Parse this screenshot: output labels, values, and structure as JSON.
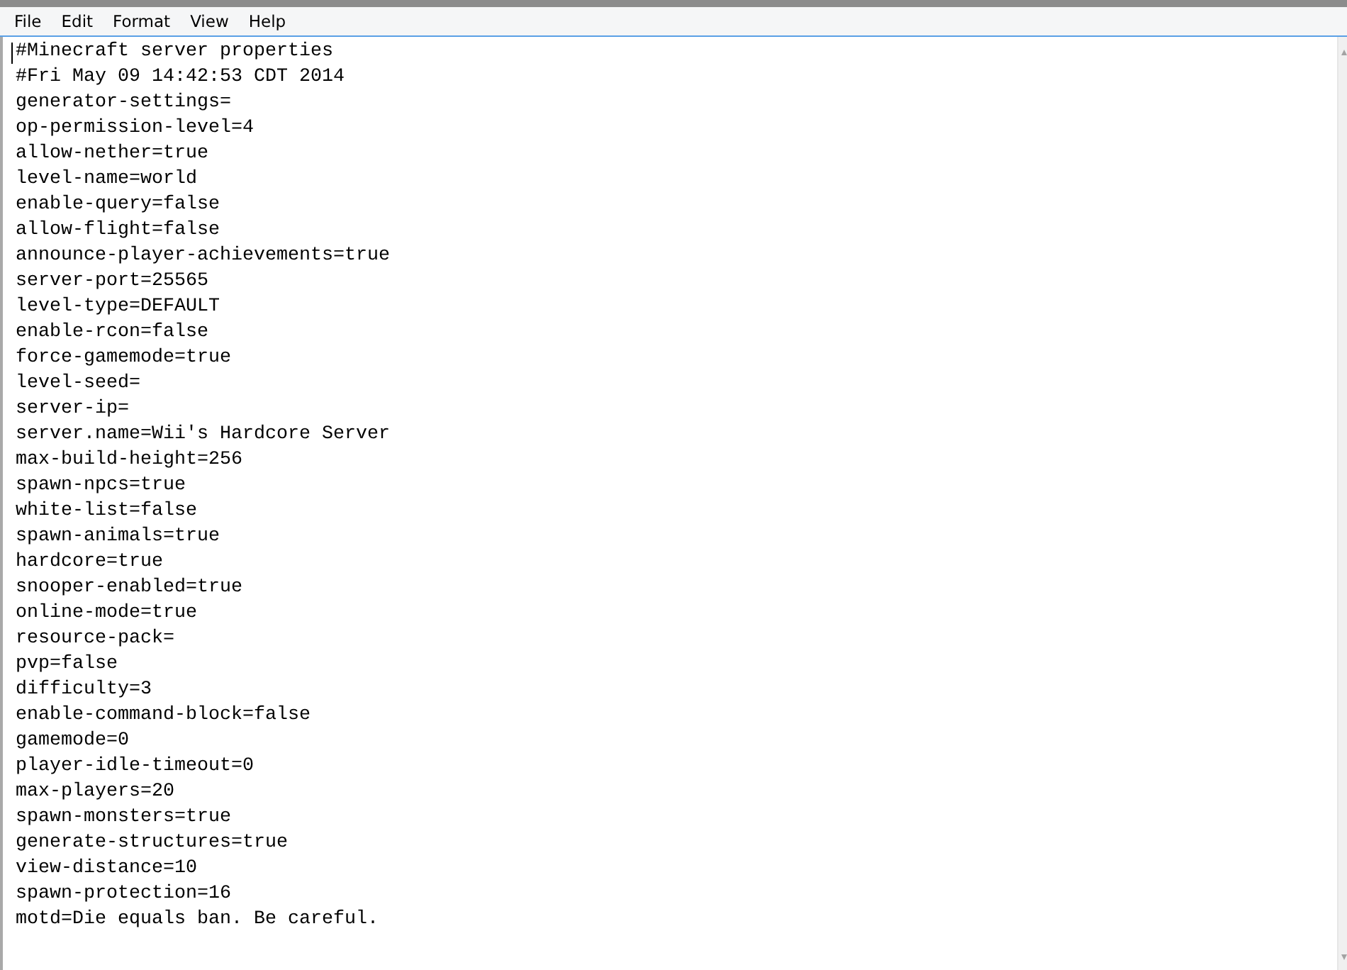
{
  "menu_bar": {
    "items": [
      {
        "label": "File"
      },
      {
        "label": "Edit"
      },
      {
        "label": "Format"
      },
      {
        "label": "View"
      },
      {
        "label": "Help"
      }
    ]
  },
  "editor": {
    "lines": [
      "#Minecraft server properties",
      "#Fri May 09 14:42:53 CDT 2014",
      "generator-settings=",
      "op-permission-level=4",
      "allow-nether=true",
      "level-name=world",
      "enable-query=false",
      "allow-flight=false",
      "announce-player-achievements=true",
      "server-port=25565",
      "level-type=DEFAULT",
      "enable-rcon=false",
      "force-gamemode=true",
      "level-seed=",
      "server-ip=",
      "server.name=Wii's Hardcore Server",
      "max-build-height=256",
      "spawn-npcs=true",
      "white-list=false",
      "spawn-animals=true",
      "hardcore=true",
      "snooper-enabled=true",
      "online-mode=true",
      "resource-pack=",
      "pvp=false",
      "difficulty=3",
      "enable-command-block=false",
      "gamemode=0",
      "player-idle-timeout=0",
      "max-players=20",
      "spawn-monsters=true",
      "generate-structures=true",
      "view-distance=10",
      "spawn-protection=16",
      "motd=Die equals ban. Be careful."
    ]
  }
}
